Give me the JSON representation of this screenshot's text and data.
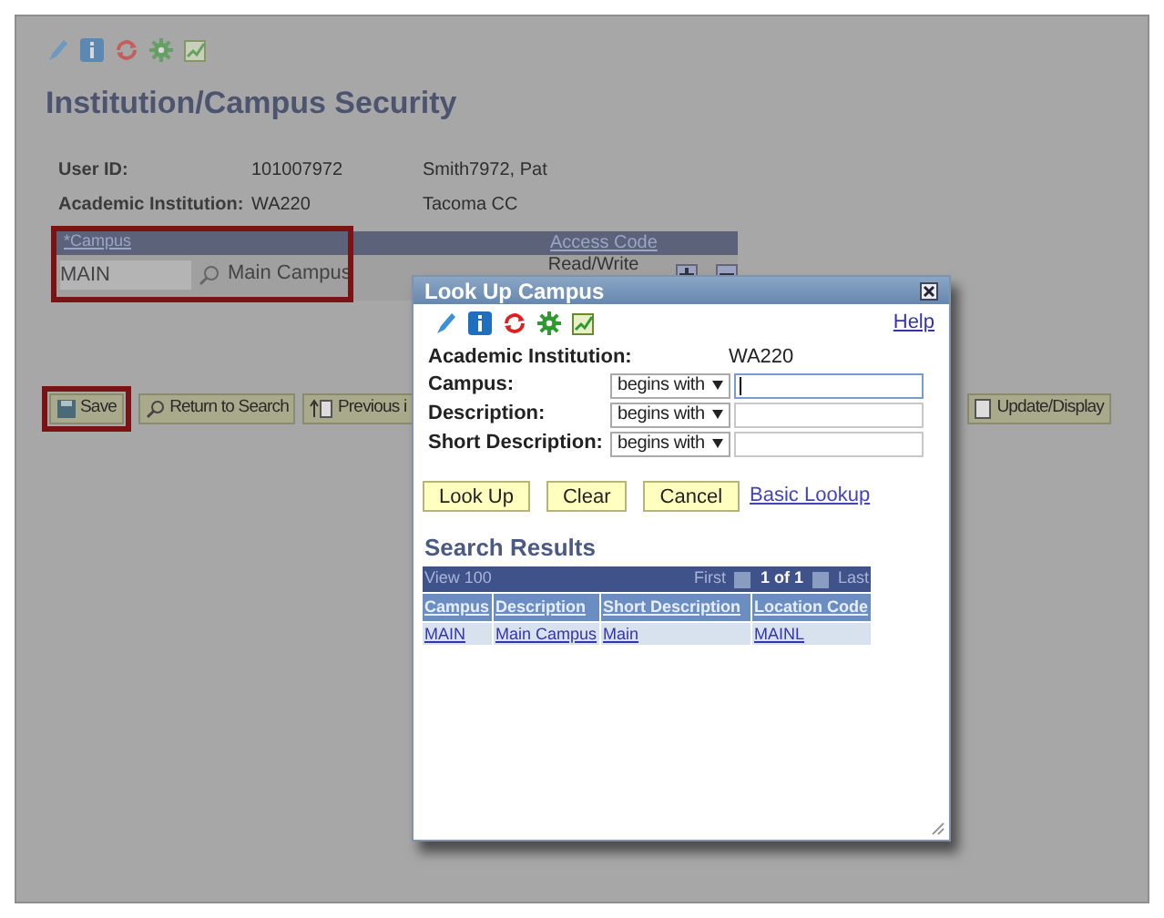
{
  "page": {
    "title": "Institution/Campus Security",
    "fields": [
      {
        "label": "User ID:",
        "value": "101007972",
        "description": "Smith7972, Pat"
      },
      {
        "label": "Academic Institution:",
        "value": "WA220",
        "description": "Tacoma CC"
      }
    ],
    "grid": {
      "columns": [
        "*Campus",
        "Access Code"
      ],
      "rows": [
        {
          "campus": "MAIN",
          "description": "Main Campus",
          "access_code": "Read/Write"
        }
      ]
    },
    "buttons": [
      {
        "label": "Save",
        "kind": "save",
        "highlighted": true
      },
      {
        "label": "Return to Search",
        "kind": "search",
        "highlighted": false
      },
      {
        "label": "Previous i",
        "kind": "previous",
        "highlighted": false
      },
      {
        "label": "Update/Display",
        "kind": "update",
        "highlighted": false
      }
    ]
  },
  "dialog": {
    "title": "Look Up Campus",
    "help": "Help",
    "institution": {
      "label": "Academic Institution:",
      "value": "WA220"
    },
    "criteria": [
      {
        "label": "Campus:",
        "operator": "begins with",
        "focused": true
      },
      {
        "label": "Description:",
        "operator": "begins with",
        "focused": false
      },
      {
        "label": "Short Description:",
        "operator": "begins with",
        "focused": false
      }
    ],
    "buttons": [
      "Look Up",
      "Clear",
      "Cancel"
    ],
    "link": "Basic Lookup",
    "results": {
      "title": "Search Results",
      "view": "View 100",
      "first": "First",
      "page": "1 of 1",
      "last": "Last",
      "columns": [
        "Campus",
        "Description",
        "Short Description",
        "Location Code"
      ],
      "rows": [
        [
          "MAIN",
          "Main Campus",
          "Main",
          "MAINL"
        ]
      ]
    }
  }
}
